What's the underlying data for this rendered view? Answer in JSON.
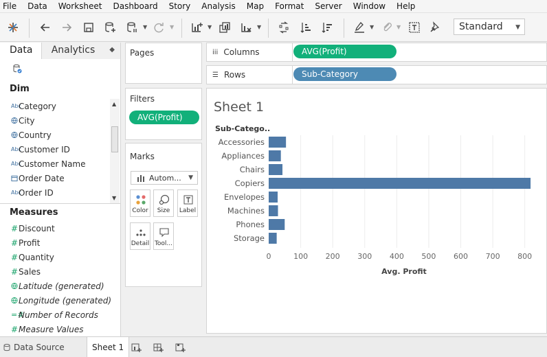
{
  "menubar": [
    "File",
    "Data",
    "Worksheet",
    "Dashboard",
    "Story",
    "Analysis",
    "Map",
    "Format",
    "Server",
    "Window",
    "Help"
  ],
  "toolbar": {
    "fit_select": "Standard"
  },
  "data_pane": {
    "tabs": {
      "data": "Data",
      "analytics": "Analytics"
    },
    "dimensions_title": "Dim",
    "dimensions": [
      {
        "icon": "Abc",
        "name": "Category",
        "italic": false
      },
      {
        "icon": "globe",
        "name": "City",
        "italic": false
      },
      {
        "icon": "globe",
        "name": "Country",
        "italic": false
      },
      {
        "icon": "Abc",
        "name": "Customer ID",
        "italic": false
      },
      {
        "icon": "Abc",
        "name": "Customer Name",
        "italic": false
      },
      {
        "icon": "calendar",
        "name": "Order Date",
        "italic": false
      },
      {
        "icon": "Abc",
        "name": "Order ID",
        "italic": false
      }
    ],
    "measures_title": "Measures",
    "measures": [
      {
        "icon": "#",
        "name": "Discount",
        "italic": false
      },
      {
        "icon": "#",
        "name": "Profit",
        "italic": false
      },
      {
        "icon": "#",
        "name": "Quantity",
        "italic": false
      },
      {
        "icon": "#",
        "name": "Sales",
        "italic": false
      },
      {
        "icon": "globe",
        "name": "Latitude (generated)",
        "italic": true
      },
      {
        "icon": "globe",
        "name": "Longitude (generated)",
        "italic": true
      },
      {
        "icon": "=#",
        "name": "Number of Records",
        "italic": true
      },
      {
        "icon": "#",
        "name": "Measure Values",
        "italic": true
      }
    ]
  },
  "pages": {
    "title": "Pages"
  },
  "filters": {
    "title": "Filters",
    "pill": "AVG(Profit)"
  },
  "marks": {
    "title": "Marks",
    "type": "Autom...",
    "buttons": [
      "Color",
      "Size",
      "Label",
      "Detail",
      "Tool..."
    ]
  },
  "columns": {
    "label": "Columns",
    "pill": "AVG(Profit)"
  },
  "rows": {
    "label": "Rows",
    "pill": "Sub-Category"
  },
  "sheet": {
    "title": "Sheet 1"
  },
  "chart_data": {
    "type": "bar",
    "orientation": "horizontal",
    "row_header": "Sub-Catego..",
    "categories": [
      "Accessories",
      "Appliances",
      "Chairs",
      "Copiers",
      "Envelopes",
      "Machines",
      "Phones",
      "Storage"
    ],
    "values": [
      54,
      38,
      43,
      818,
      28,
      29,
      50,
      25
    ],
    "xlabel": "Avg. Profit",
    "xlim": [
      0,
      820
    ],
    "xticks": [
      0,
      100,
      200,
      300,
      400,
      500,
      600,
      700,
      800
    ],
    "bar_color": "#4e79a7",
    "grid": "vertical"
  },
  "bottom_tabs": {
    "data_source": "Data Source",
    "sheet": "Sheet 1"
  }
}
